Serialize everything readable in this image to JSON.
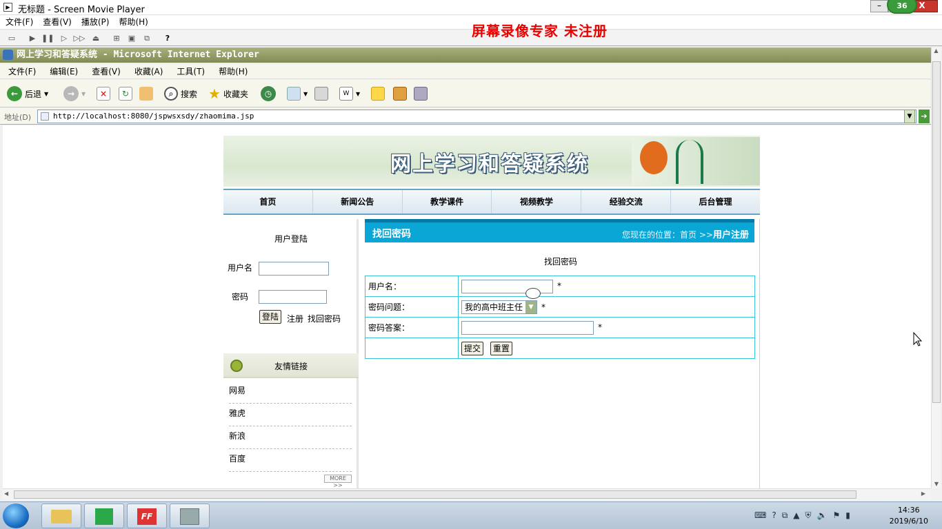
{
  "player": {
    "title": "无标题 - Screen Movie Player",
    "menu": [
      "文件(F)",
      "查看(V)",
      "播放(P)",
      "帮助(H)"
    ],
    "watermark": "屏幕录像专家  未注册",
    "badge": "36"
  },
  "ie": {
    "title": "网上学习和答疑系统 - Microsoft Internet Explorer",
    "menu": [
      "文件(F)",
      "编辑(E)",
      "查看(V)",
      "收藏(A)",
      "工具(T)",
      "帮助(H)"
    ],
    "back_label": "后退",
    "search_label": "搜索",
    "favorites_label": "收藏夹",
    "address_label": "地址(D)",
    "address": "http://localhost:8080/jspwsxsdy/zhaomima.jsp"
  },
  "site": {
    "banner_title": "网上学习和答疑系统",
    "nav": [
      "首页",
      "新闻公告",
      "教学课件",
      "视频教学",
      "经验交流",
      "后台管理"
    ],
    "login": {
      "heading": "用户登陆",
      "username_label": "用户名",
      "password_label": "密码",
      "login_button": "登陆",
      "register_link": "注册",
      "recover_link": "找回密码"
    },
    "friends": {
      "heading": "友情链接",
      "links": [
        "网易",
        "雅虎",
        "新浪",
        "百度"
      ],
      "more": "MORE >>"
    },
    "panel": {
      "title": "找回密码",
      "location_prefix": "您现在的位置：首页 >>",
      "location_current": "用户注册"
    },
    "form": {
      "title": "找回密码",
      "username_label": "用户名：",
      "question_label": "密码问题：",
      "question_value": "我的高中班主任",
      "answer_label": "密码答案：",
      "required": "*",
      "submit": "提交",
      "reset": "重置"
    }
  },
  "taskbar": {
    "time": "14:36",
    "date": "2019/6/10"
  }
}
